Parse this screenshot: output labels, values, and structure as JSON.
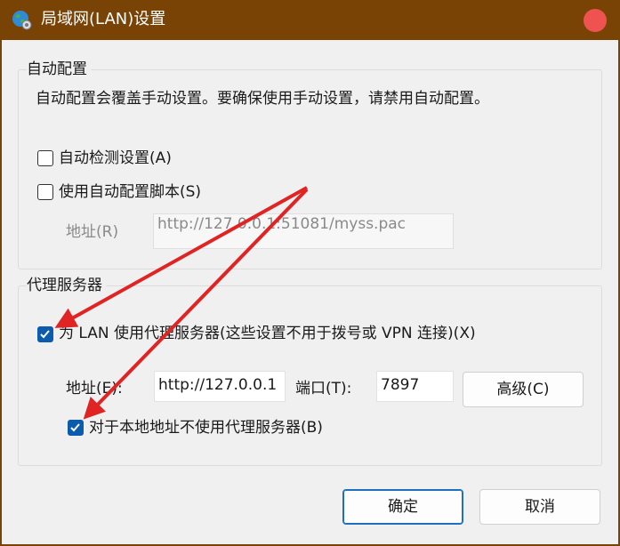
{
  "window": {
    "title": "局域网(LAN)设置",
    "icon": "globe-settings-icon",
    "close_color": "#ef5350"
  },
  "auto_config": {
    "group_label": "自动配置",
    "description": "自动配置会覆盖手动设置。要确保使用手动设置，请禁用自动配置。",
    "auto_detect": {
      "label": "自动检测设置(A)",
      "checked": false
    },
    "use_script": {
      "label": "使用自动配置脚本(S)",
      "checked": false
    },
    "address_label": "地址(R)",
    "address_value": "http://127.0.0.1:51081/myss.pac"
  },
  "proxy": {
    "group_label": "代理服务器",
    "use_proxy": {
      "label": "为 LAN 使用代理服务器(这些设置不用于拨号或 VPN 连接)(X)",
      "checked": true
    },
    "address_label": "地址(E):",
    "address_value": "http://127.0.0.1",
    "port_label": "端口(T):",
    "port_value": "7897",
    "advanced_label": "高级(C)",
    "bypass_local": {
      "label": "对于本地地址不使用代理服务器(B)",
      "checked": true
    }
  },
  "buttons": {
    "ok": "确定",
    "cancel": "取消"
  },
  "annotation": {
    "arrow_color": "#e02424",
    "arrow_count": 2
  }
}
